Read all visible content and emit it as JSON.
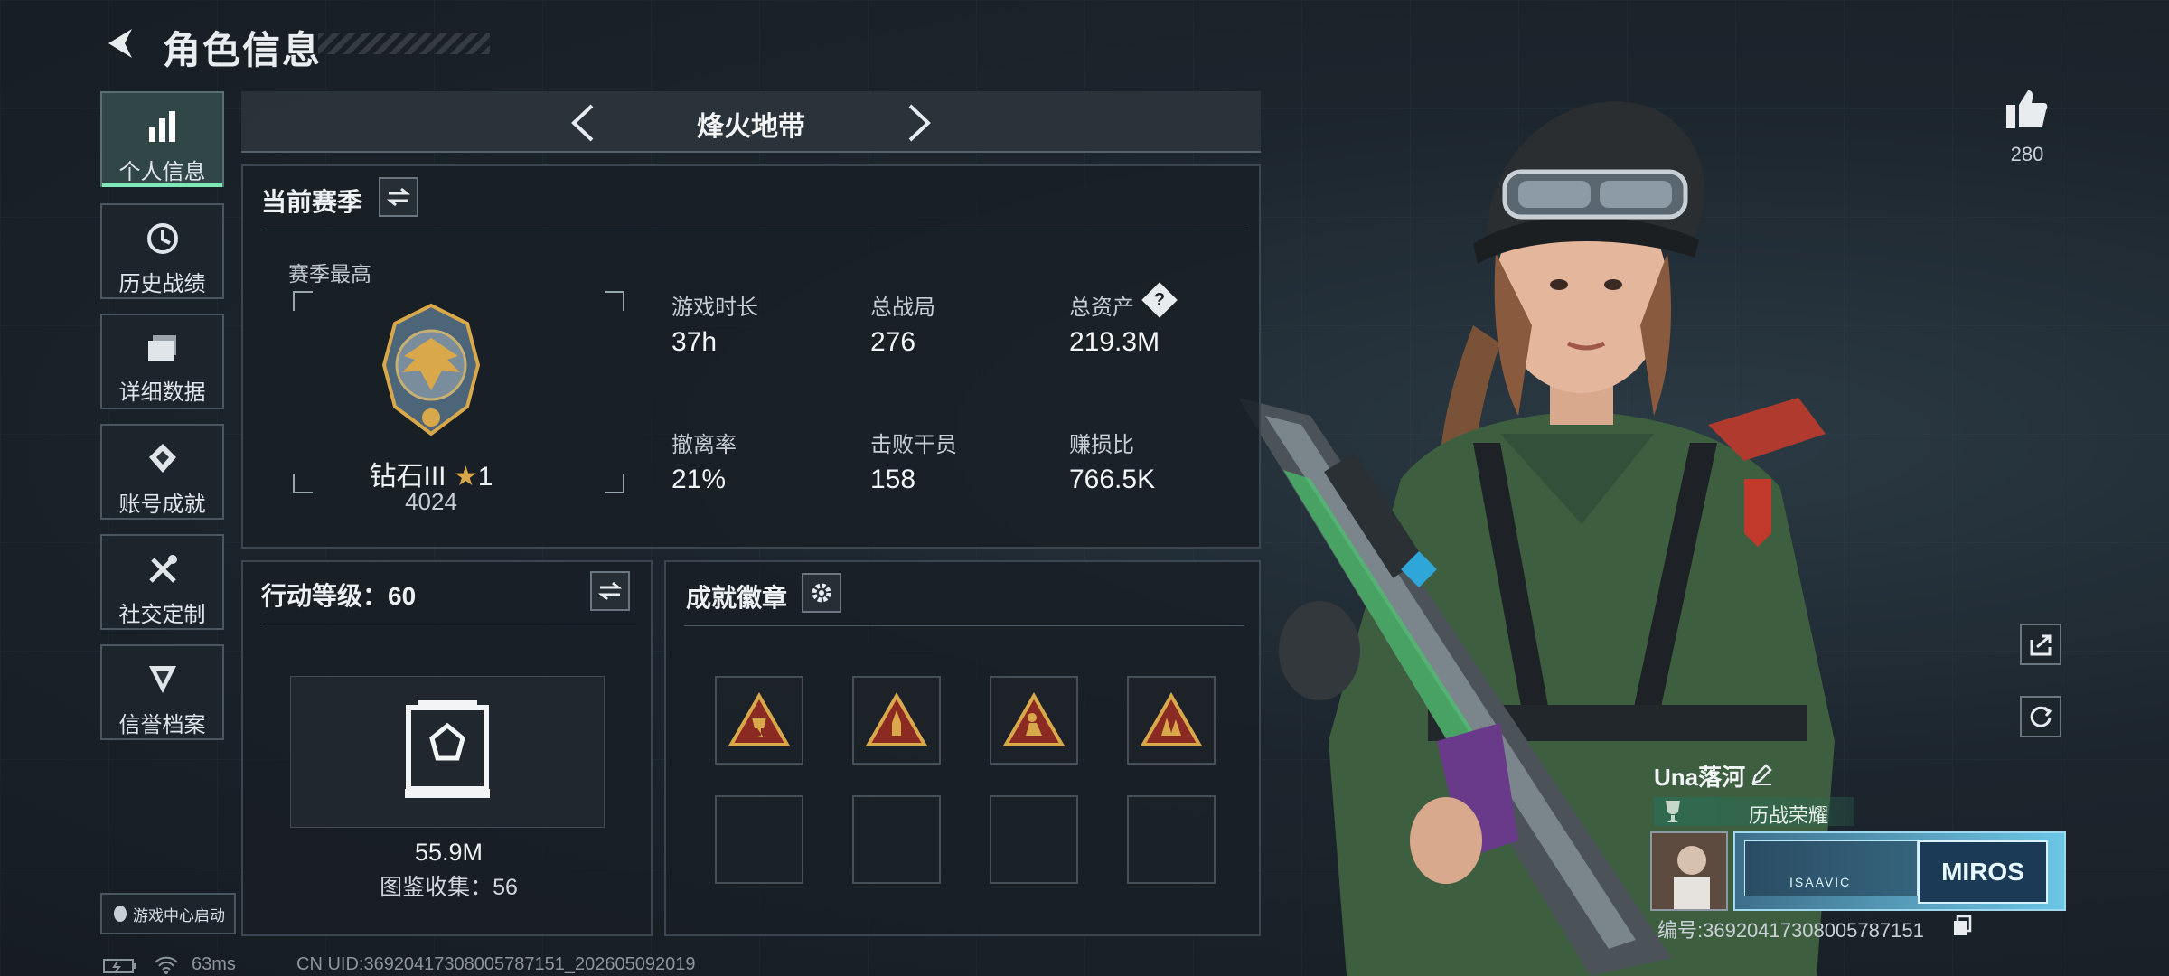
{
  "header": {
    "title": "角色信息"
  },
  "nav": [
    {
      "label": "个人信息",
      "icon": "bar-chart-icon",
      "active": true
    },
    {
      "label": "历史战绩",
      "icon": "history-icon"
    },
    {
      "label": "详细数据",
      "icon": "folder-icon"
    },
    {
      "label": "账号成就",
      "icon": "achievement-icon"
    },
    {
      "label": "社交定制",
      "icon": "tools-icon"
    },
    {
      "label": "信誉档案",
      "icon": "shield-icon"
    }
  ],
  "mode_tab": {
    "title": "烽火地带"
  },
  "season": {
    "title": "当前赛季",
    "best_label": "赛季最高",
    "rank_name": "钻石III",
    "rank_stars": "1",
    "rank_score": "4024",
    "stats": [
      {
        "label": "游戏时长",
        "value": "37h"
      },
      {
        "label": "总战局",
        "value": "276"
      },
      {
        "label": "总资产",
        "value": "219.3M",
        "help": "?"
      },
      {
        "label": "撤离率",
        "value": "21%"
      },
      {
        "label": "击败干员",
        "value": "158"
      },
      {
        "label": "赚损比",
        "value": "766.5K"
      }
    ]
  },
  "action_level": {
    "title": "行动等级：60",
    "value": "55.9M",
    "collection": "图鉴收集：56"
  },
  "badges": {
    "title": "成就徽章",
    "slots_filled": 4,
    "slots_empty": 4
  },
  "likes": {
    "count": "280"
  },
  "player": {
    "name": "Una落河",
    "honor": "历战荣耀",
    "card_text": "ISAAVIC",
    "card_logo": "MIROS",
    "id_line": "编号:36920417308005787151"
  },
  "game_center": {
    "label": "游戏中心启动"
  },
  "status": {
    "ping": "63ms",
    "uid": "CN UID:36920417308005787151_202605092019"
  },
  "colors": {
    "accent": "#7fe8b8",
    "panel_border": "#3b4650",
    "gold": "#d8a84a",
    "honor_bg": "#2f6a50"
  }
}
